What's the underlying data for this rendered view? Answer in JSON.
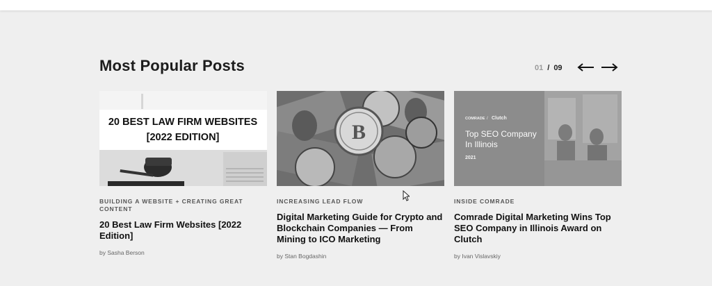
{
  "section": {
    "title": "Most Popular Posts",
    "pager": {
      "current": "01",
      "separator": "/",
      "total": "09"
    }
  },
  "posts": [
    {
      "category": "BUILDING A WEBSITE + CREATING GREAT CONTENT",
      "title": "20 Best Law Firm Websites [2022 Edition]",
      "author": "by Sasha Berson",
      "image": {
        "line1": "20 BEST LAW FIRM WEBSITES",
        "line2": "[2022 EDITION]"
      }
    },
    {
      "category": "INCREASING LEAD FLOW",
      "title": "Digital Marketing Guide for Crypto and Blockchain Companies — From Mining to ICO Marketing",
      "author": "by Stan Bogdashin",
      "image": {
        "coin": "B"
      }
    },
    {
      "category": "INSIDE COMRADE",
      "title": "Comrade Digital Marketing Wins Top SEO Company in Illinois Award on Clutch",
      "author": "by Ivan Vislavskiy",
      "image": {
        "logo": "COMRADE",
        "sep": "/",
        "partner": "Clutch",
        "line1": "Top SEO Company",
        "line2": "In Illinois",
        "year": "2021"
      }
    }
  ]
}
